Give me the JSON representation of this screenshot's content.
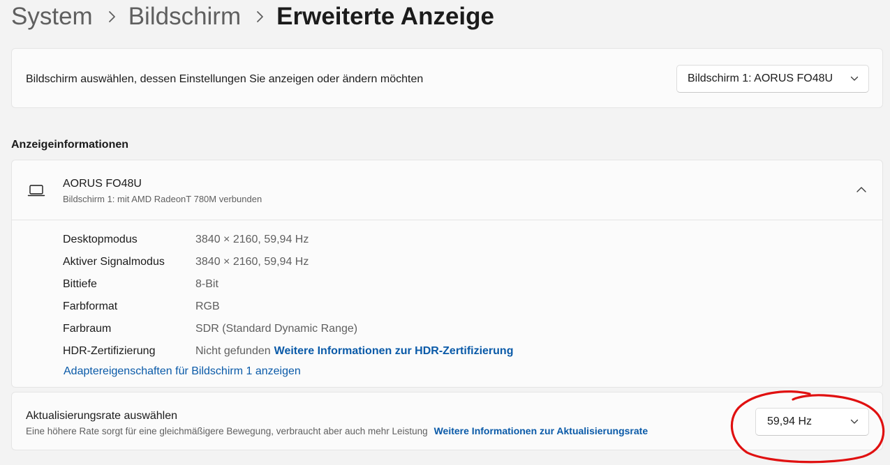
{
  "breadcrumb": {
    "items": [
      "System",
      "Bildschirm"
    ],
    "current": "Erweiterte Anzeige"
  },
  "monitor_select": {
    "label": "Bildschirm auswählen, dessen Einstellungen Sie anzeigen oder ändern möchten",
    "selected": "Bildschirm 1: AORUS FO48U"
  },
  "section_title": "Anzeigeinformationen",
  "display_info": {
    "name": "AORUS FO48U",
    "subtitle": "Bildschirm 1: mit AMD RadeonT 780M verbunden",
    "rows": [
      {
        "key": "Desktopmodus",
        "value": "3840 × 2160, 59,94 Hz"
      },
      {
        "key": "Aktiver Signalmodus",
        "value": "3840 × 2160, 59,94 Hz"
      },
      {
        "key": "Bittiefe",
        "value": "8-Bit"
      },
      {
        "key": "Farbformat",
        "value": "RGB"
      },
      {
        "key": "Farbraum",
        "value": "SDR (Standard Dynamic Range)"
      },
      {
        "key": "HDR-Zertifizierung",
        "value": "Nicht gefunden",
        "link": "Weitere Informationen zur HDR-Zertifizierung"
      }
    ],
    "adapter_link": "Adaptereigenschaften für Bildschirm 1 anzeigen"
  },
  "refresh_rate": {
    "title": "Aktualisierungsrate auswählen",
    "description": "Eine höhere Rate sorgt für eine gleichmäßigere Bewegung, verbraucht aber auch mehr Leistung",
    "link": "Weitere Informationen zur Aktualisierungsrate",
    "selected": "59,94 Hz"
  },
  "colors": {
    "background": "#f3f3f3",
    "card": "#fbfbfb",
    "link": "#0a5aa8",
    "annotation": "#e01010"
  },
  "icons": {
    "breadcrumb_separator": "chevron-right-icon",
    "dropdown": "chevron-down-icon",
    "display": "laptop-icon",
    "collapse": "chevron-up-icon"
  }
}
